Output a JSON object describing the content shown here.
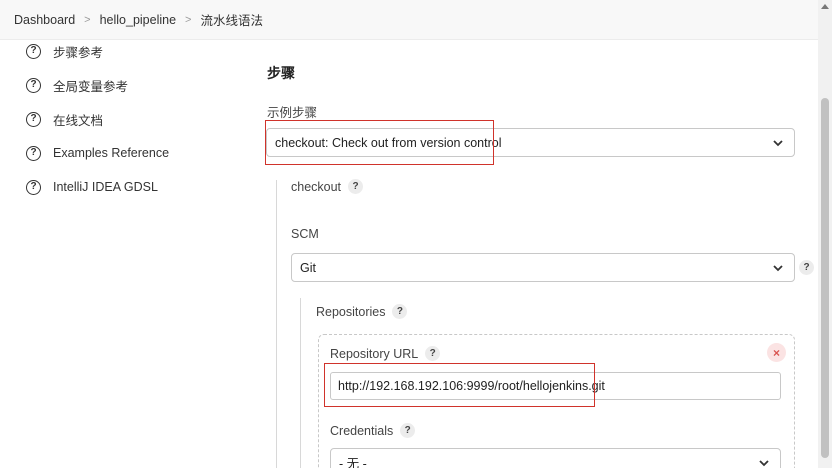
{
  "breadcrumb": {
    "items": [
      "Dashboard",
      "hello_pipeline",
      "流水线语法"
    ],
    "separator": ">"
  },
  "sidebar": {
    "items": [
      {
        "label": "步骤参考",
        "icon": "help-circle-icon"
      },
      {
        "label": "全局变量参考",
        "icon": "help-circle-icon"
      },
      {
        "label": "在线文档",
        "icon": "help-circle-icon"
      },
      {
        "label": "Examples Reference",
        "icon": "help-circle-icon"
      },
      {
        "label": "IntelliJ IDEA GDSL",
        "icon": "help-circle-icon"
      }
    ]
  },
  "main": {
    "section_title": "步骤",
    "sample_step_label": "示例步骤",
    "sample_step_value": "checkout: Check out from version control",
    "checkout_label": "checkout",
    "scm_label": "SCM",
    "scm_value": "Git",
    "repositories_label": "Repositories",
    "repository_url_label": "Repository URL",
    "repository_url_value": "http://192.168.192.106:9999/root/hellojenkins.git",
    "credentials_label": "Credentials",
    "credentials_value": "- 无 -",
    "help_glyph": "?",
    "delete_glyph": "×"
  },
  "colors": {
    "highlight": "#d0332b",
    "delete_button": "#d9534f"
  }
}
